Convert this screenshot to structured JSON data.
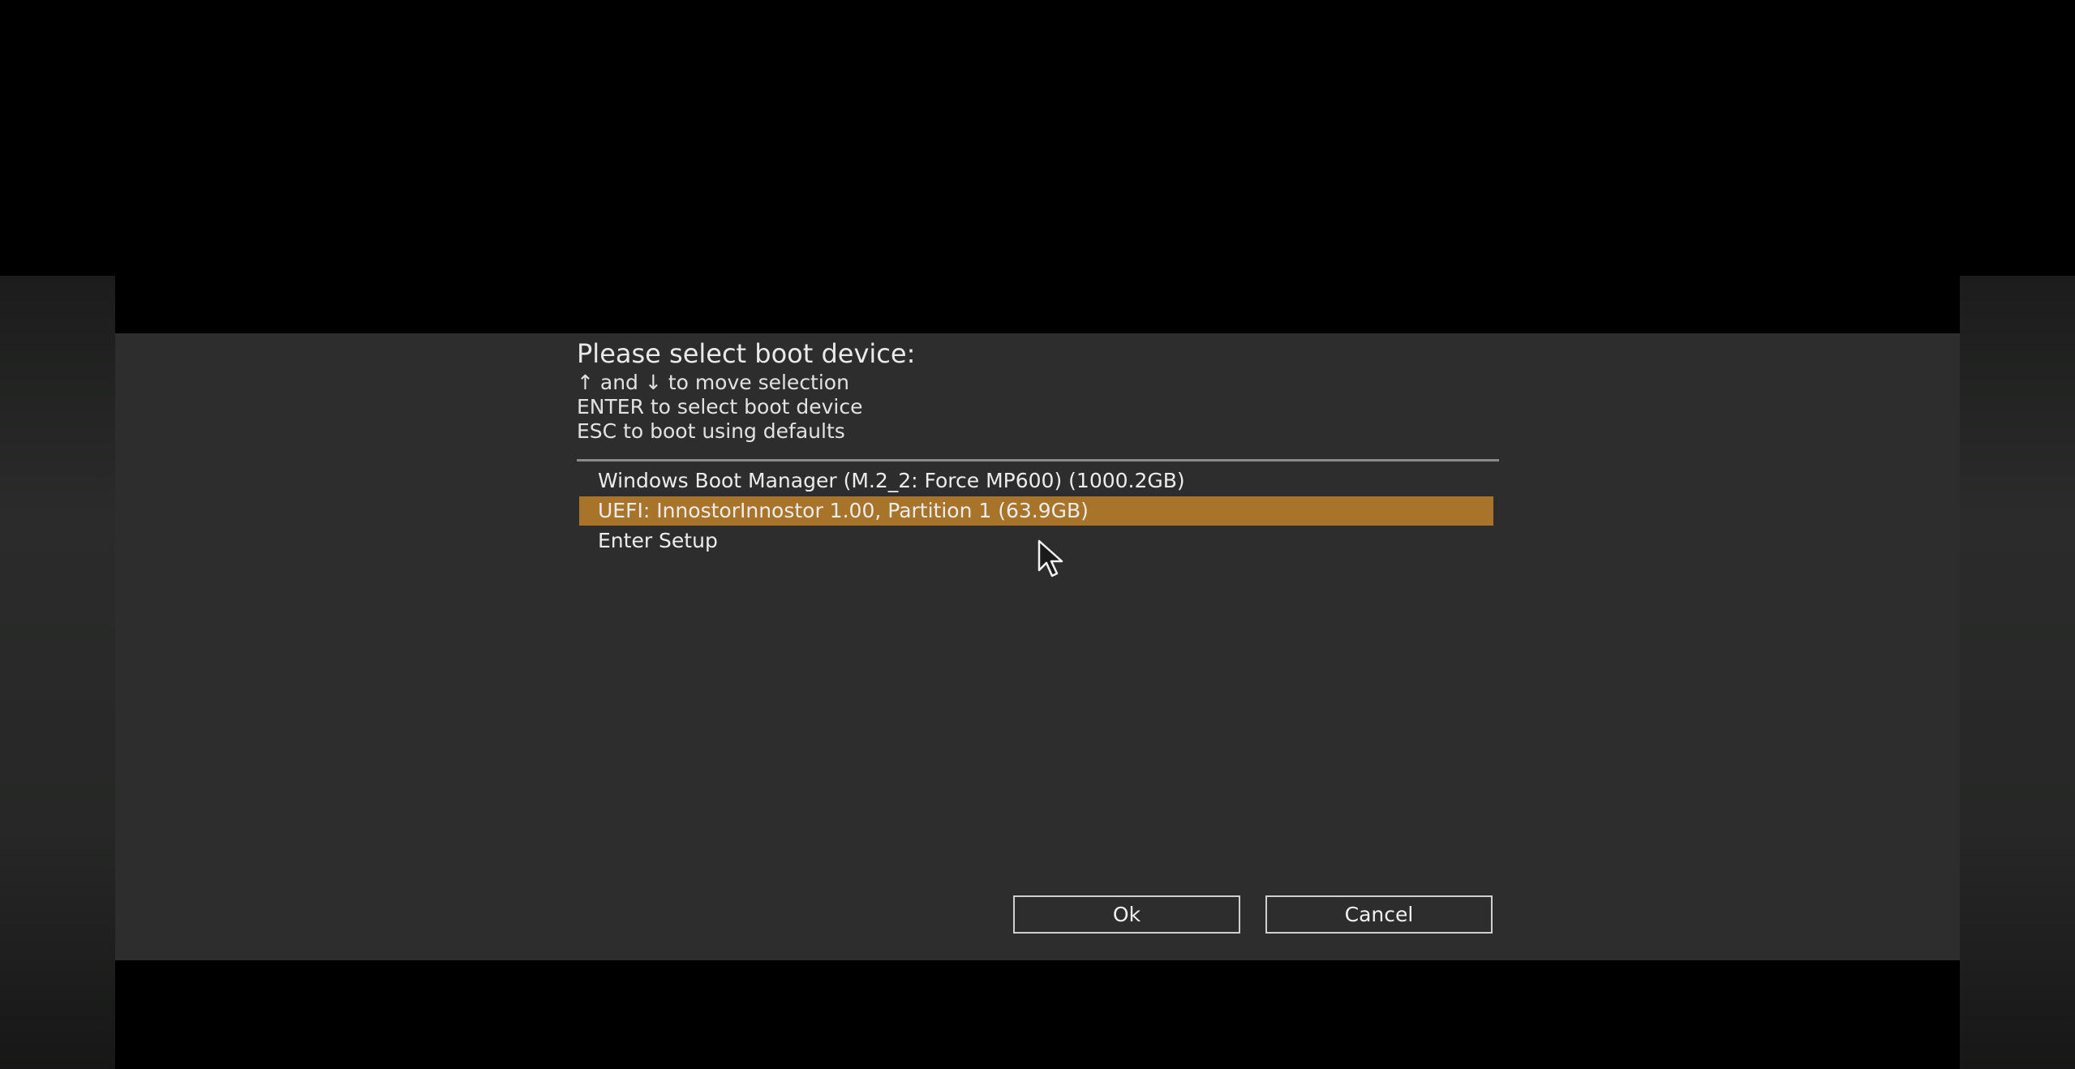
{
  "dialog": {
    "title": "Please select boot device:",
    "hints": [
      "↑ and ↓ to move selection",
      "ENTER to select boot device",
      "ESC to boot using defaults"
    ],
    "boot_devices": [
      {
        "label": "Windows Boot Manager (M.2_2: Force MP600) (1000.2GB)",
        "selected": false
      },
      {
        "label": "UEFI: InnostorInnostor 1.00, Partition 1 (63.9GB)",
        "selected": true
      },
      {
        "label": "Enter Setup",
        "selected": false
      }
    ],
    "buttons": {
      "ok_label": "Ok",
      "cancel_label": "Cancel"
    }
  },
  "colors": {
    "dialog_background": "#2c2d2c",
    "selection_highlight": "#a8742a",
    "text": "#ececec",
    "screen_background": "#000000"
  },
  "icons": {
    "cursor": "mouse-pointer-icon"
  }
}
